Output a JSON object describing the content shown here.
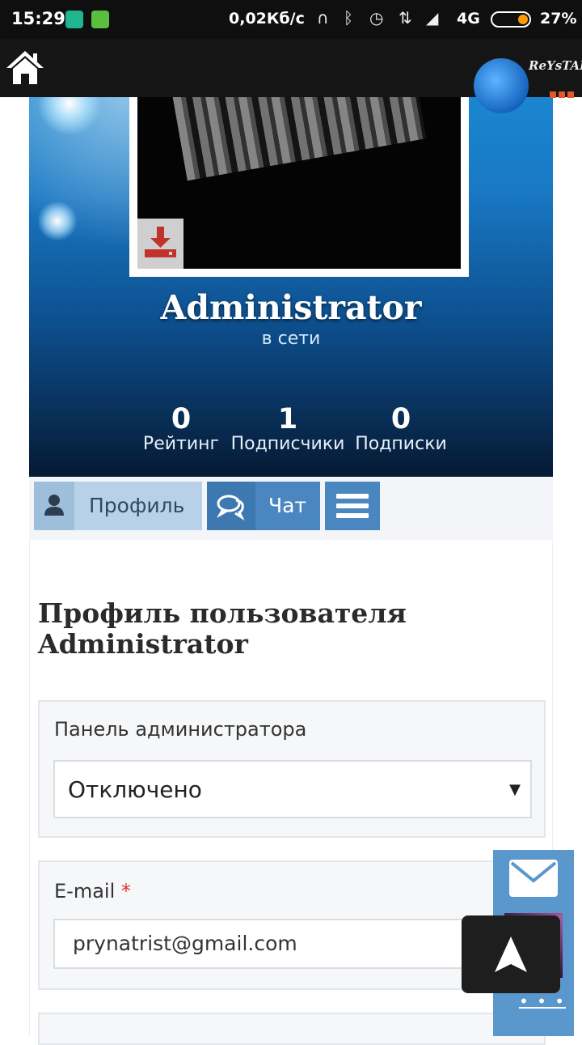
{
  "status_bar": {
    "time": "15:29",
    "net_speed": "0,02Кб/с",
    "network_type": "4G",
    "battery_percent": "27%",
    "battery_level": 0.27,
    "icons": [
      "shield-icon",
      "android-icon",
      "headphones-icon",
      "bluetooth-icon",
      "alarm-icon",
      "data-arrows-icon",
      "signal-icon",
      "battery-icon"
    ]
  },
  "top_bar": {
    "home_icon": "home-icon",
    "logo_text": "ReYsTAFF"
  },
  "profile": {
    "username": "Administrator",
    "status": "в сети",
    "stats": [
      {
        "value": "0",
        "label": "Рейтинг"
      },
      {
        "value": "1",
        "label": "Подписчики"
      },
      {
        "value": "0",
        "label": "Подписки"
      }
    ]
  },
  "tabs": {
    "profile_label": "Профиль",
    "chat_label": "Чат",
    "menu_icon": "hamburger-icon"
  },
  "content": {
    "title": "Профиль пользователя Administrator",
    "admin_panel": {
      "label": "Панель администратора",
      "selected": "Отключено"
    },
    "email": {
      "label": "E-mail",
      "required_mark": "*",
      "value": "prynatrist@gmail.com"
    }
  },
  "widgets": {
    "mail_icon": "envelope-icon",
    "more_label": "• • •",
    "scroll_top_icon": "arrow-up-icon"
  },
  "colors": {
    "tab_accent": "#4a87c0",
    "tab_profile": "#b8d1e8",
    "required": "#e0312a",
    "battery": "#ff9b00"
  }
}
